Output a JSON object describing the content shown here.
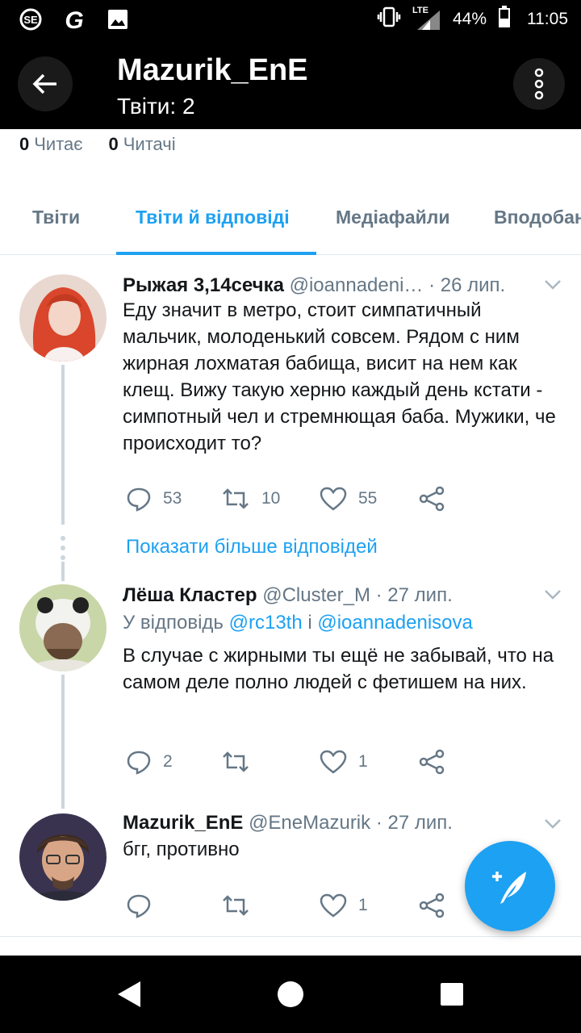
{
  "status_bar": {
    "network": "LTE",
    "battery": "44%",
    "time": "11:05"
  },
  "header": {
    "title": "Mazurik_EnE",
    "subtitle": "Твіти: 2"
  },
  "follow": {
    "following_count": "0",
    "following_label": "Читає",
    "followers_count": "0",
    "followers_label": "Читачі"
  },
  "tabs": [
    {
      "label": "Твіти"
    },
    {
      "label": "Твіти й відповіді"
    },
    {
      "label": "Медіафайли"
    },
    {
      "label": "Вподобан"
    }
  ],
  "tweets": [
    {
      "name": "Рыжая 3,14сечка",
      "handle": "@ioannadeni…",
      "date": "· 26 лип.",
      "text": "Еду значит в метро, стоит симпатичный мальчик, молоденький совсем. Рядом с ним жирная лохматая бабища, висит на нем как клещ. Вижу такую херню каждый день кстати - симпотный чел и стремнющая баба. Мужики, че происходит то?",
      "replies": "53",
      "retweets": "10",
      "likes": "55"
    },
    {
      "name": "Лёша Кластер",
      "handle": "@Cluster_M",
      "date": "· 27 лип.",
      "reply_prefix": "У відповідь ",
      "reply_user1": "@rc13th",
      "reply_and": " і ",
      "reply_user2": "@ioannadenisova",
      "text": "В случае с жирными ты ещё не забывай, что на самом деле полно людей с фетишем на них.",
      "replies": "2",
      "retweets": "",
      "likes": "1"
    },
    {
      "name": "Mazurik_EnE",
      "handle": "@EneMazurik",
      "date": "· 27 лип.",
      "text": "бгг, противно",
      "replies": "",
      "retweets": "",
      "likes": "1"
    }
  ],
  "show_more": "Показати більше відповідей",
  "colors": {
    "accent": "#1da1f2",
    "text": "#14171a",
    "muted": "#657786"
  }
}
